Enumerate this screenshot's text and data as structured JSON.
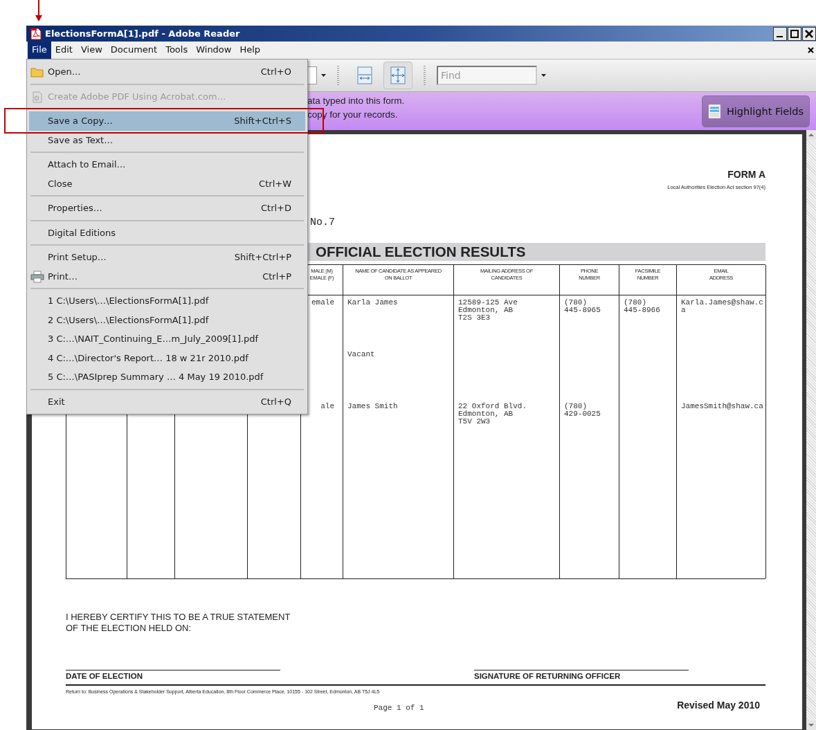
{
  "window": {
    "title": "ElectionsFormA[1].pdf - Adobe Reader"
  },
  "menu_bar": [
    {
      "label": "File",
      "selected": true
    },
    {
      "label": "Edit",
      "selected": false
    },
    {
      "label": "View",
      "selected": false
    },
    {
      "label": "Document",
      "selected": false
    },
    {
      "label": "Tools",
      "selected": false
    },
    {
      "label": "Window",
      "selected": false
    },
    {
      "label": "Help",
      "selected": false
    }
  ],
  "file_menu": [
    {
      "kind": "command",
      "label": "Open…",
      "shortcut": "Ctrl+O",
      "disabled": false,
      "selected": false
    },
    {
      "kind": "separator"
    },
    {
      "kind": "command",
      "label": "Create Adobe PDF Using Acrobat.com…",
      "disabled": true,
      "selected": false
    },
    {
      "kind": "separator"
    },
    {
      "kind": "command",
      "label": "Save a Copy…",
      "shortcut": "Shift+Ctrl+S",
      "disabled": false,
      "selected": true
    },
    {
      "kind": "command",
      "label": "Save as Text…",
      "disabled": false,
      "selected": false
    },
    {
      "kind": "separator"
    },
    {
      "kind": "command",
      "label": "Attach to Email…",
      "disabled": false,
      "selected": false
    },
    {
      "kind": "command",
      "label": "Close",
      "shortcut": "Ctrl+W",
      "disabled": false,
      "selected": false
    },
    {
      "kind": "separator"
    },
    {
      "kind": "command",
      "label": "Properties…",
      "shortcut": "Ctrl+D",
      "disabled": false,
      "selected": false
    },
    {
      "kind": "separator"
    },
    {
      "kind": "command",
      "label": "Digital Editions",
      "disabled": false,
      "selected": false
    },
    {
      "kind": "separator"
    },
    {
      "kind": "command",
      "label": "Print Setup…",
      "shortcut": "Shift+Ctrl+P",
      "disabled": false,
      "selected": false
    },
    {
      "kind": "command",
      "label": "Print…",
      "shortcut": "Ctrl+P",
      "disabled": false,
      "selected": false
    },
    {
      "kind": "separator"
    },
    {
      "kind": "command",
      "label": "1 C:\\Users\\…\\ElectionsFormA[1].pdf",
      "disabled": false,
      "selected": false
    },
    {
      "kind": "command",
      "label": "2 C:\\Users\\…\\ElectionsFormA[1].pdf",
      "disabled": false,
      "selected": false
    },
    {
      "kind": "command",
      "label": "3 C:…\\NAIT_Continuing_E…m_July_2009[1].pdf",
      "disabled": false,
      "selected": false
    },
    {
      "kind": "command",
      "label": "4 C:…\\Director's Report… 18 w 21r 2010.pdf",
      "disabled": false,
      "selected": false
    },
    {
      "kind": "command",
      "label": "5 C:…\\PASIprep Summary … 4 May 19 2010.pdf",
      "disabled": false,
      "selected": false
    },
    {
      "kind": "separator"
    },
    {
      "kind": "command",
      "label": "Exit",
      "shortcut": "Ctrl+Q",
      "disabled": false,
      "selected": false
    }
  ],
  "toolbar": {
    "view_buttons": [
      {
        "selected": false
      },
      {
        "selected": true
      }
    ],
    "find": {
      "placeholder": "Find"
    }
  },
  "form_bar": {
    "message": [
      "ata typed into this form.",
      "copy for your records."
    ],
    "button": "Highlight Fields"
  },
  "document": {
    "form_title": "FORM A",
    "act": "Local Authorities Election Act section 97(4)",
    "number": "No.7",
    "heading": "OFFICIAL ELECTION RESULTS",
    "table": {
      "header": {
        "column_5": "MALE (M)\nEMALE (F)",
        "column_6": "NAME OF CANDIDATE AS APPEARED\nON BALLOT",
        "column_7": "MAILING ADDRESS OF\nCANDIDATES",
        "column_8": "PHONE\nNUMBER",
        "column_9": "FACSIMILE\nNUMBER",
        "column_10": "EMAIL\nADDRESS"
      },
      "rows": [
        {
          "column_5": "emale",
          "column_6": "Karla James",
          "column_7": "12589-125 Ave\nEdmonton, AB\nT2S 3E3",
          "column_8": "(780)\n445-8965",
          "column_9": "(780)\n445-8966",
          "column_10": "Karla.James@shaw.ca"
        },
        {
          "column_6": "Vacant"
        },
        {
          "column_5": "ale",
          "column_6": "James Smith",
          "column_7": "22 Oxford Blvd.\nEdmonton, AB\nT5V 2W3",
          "column_8": "(780)\n429-0025",
          "column_10": "JamesSmith@shaw.ca"
        }
      ]
    },
    "certify": "I HEREBY CERTIFY THIS TO BE A TRUE STATEMENT\nOF THE ELECTION HELD ON:",
    "signature_labels": [
      "DATE OF ELECTION",
      "SIGNATURE OF RETURNING OFFICER"
    ],
    "return_address": "Return to: Business Operations & Stakeholder Support, Alberta Education, 8th Floor Commerce Place, 10155 - 102 Street, Edmonton, AB T5J 4L5",
    "page_number": "Page 1 of 1",
    "revised": "Revised May 2010"
  }
}
